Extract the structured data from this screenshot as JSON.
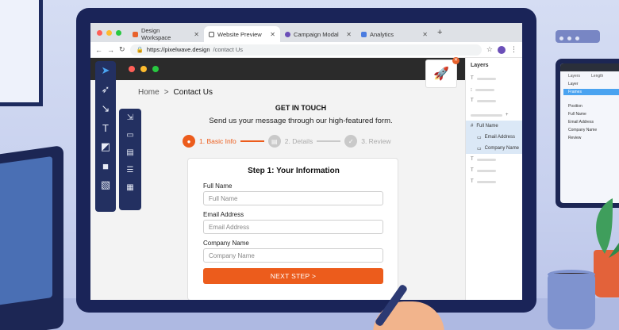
{
  "browser": {
    "tabs": [
      {
        "label": "Design Workspace",
        "color": "#e8622c",
        "active": false
      },
      {
        "label": "Website Preview",
        "color": "#4a7ce0",
        "active": true
      },
      {
        "label": "Campaign Modal",
        "color": "#6b4fb8",
        "active": false
      },
      {
        "label": "Analytics",
        "color": "#4a7ce0",
        "active": false
      }
    ],
    "new_tab": "+",
    "url_host": "https://pixelwave.design",
    "url_path": "/contact Us"
  },
  "breadcrumb": {
    "home": "Home",
    "sep": ">",
    "current": "Contact Us"
  },
  "page": {
    "headline": "GET IN TOUCH",
    "subheadline": "Send us your message through our high-featured form."
  },
  "steps": [
    {
      "label": "1. Basic Info",
      "state": "active",
      "color": "#ec5c1c"
    },
    {
      "label": "2. Details",
      "state": "pending",
      "color": "#c9c9c9"
    },
    {
      "label": "3. Review",
      "state": "pending",
      "color": "#c9c9c9"
    }
  ],
  "form": {
    "title": "Step 1: Your Information",
    "full_name_label": "Full Name",
    "full_name_placeholder": "Full Name",
    "email_label": "Email Address",
    "email_placeholder": "Email Address",
    "company_label": "Company Name",
    "company_placeholder": "Company Name",
    "submit": "NEXT STEP >"
  },
  "layers": {
    "title": "Layers",
    "selected": [
      "Full Name",
      "Email Address",
      "Company Name"
    ]
  },
  "tablet": {
    "tabs": [
      "Layers",
      "Length"
    ],
    "rows": [
      "Layer",
      "Frames",
      "Position",
      "Full Name",
      "Email Address",
      "Company Name",
      "Review"
    ]
  },
  "colors": {
    "accent": "#ec5c1c",
    "toolbar": "#233061"
  }
}
